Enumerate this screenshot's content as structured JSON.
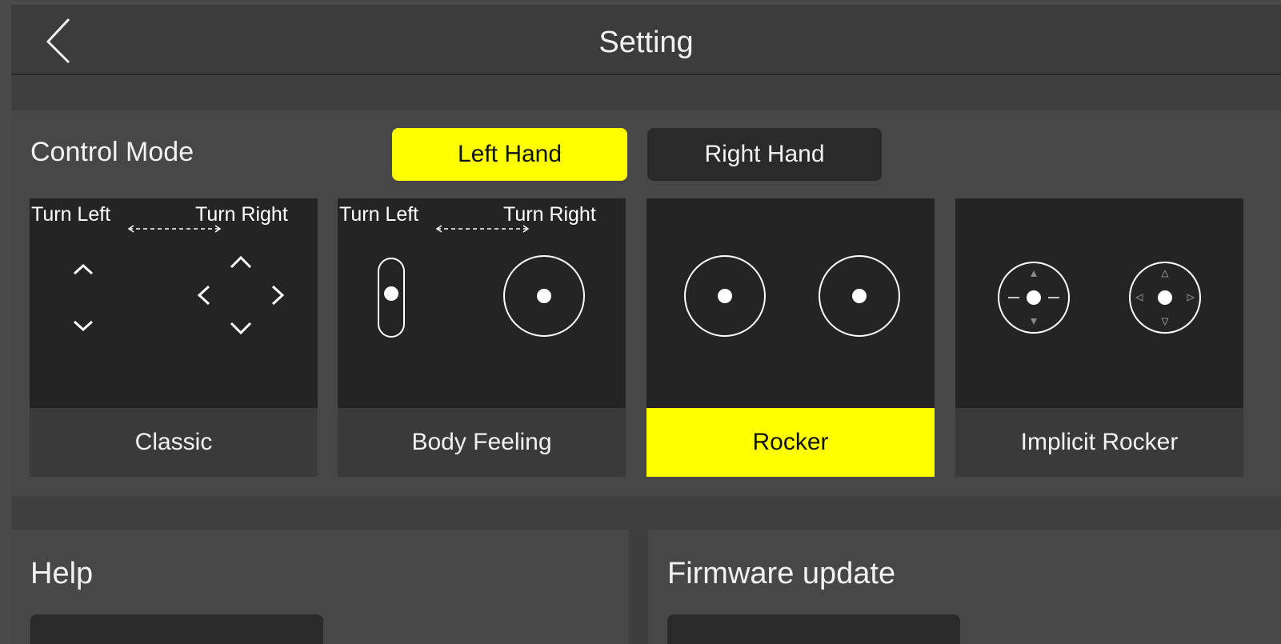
{
  "header": {
    "title": "Setting",
    "back_icon": "chevron-left-icon"
  },
  "control_mode": {
    "label": "Control Mode",
    "hands": [
      {
        "label": "Left Hand",
        "selected": true
      },
      {
        "label": "Right Hand",
        "selected": false
      }
    ],
    "modes": [
      {
        "name": "Classic",
        "turn_left": "Turn Left",
        "turn_right": "Turn Right",
        "selected": false
      },
      {
        "name": "Body Feeling",
        "turn_left": "Turn Left",
        "turn_right": "Turn Right",
        "selected": false
      },
      {
        "name": "Rocker",
        "selected": true
      },
      {
        "name": "Implicit Rocker",
        "selected": false
      }
    ]
  },
  "help": {
    "title": "Help"
  },
  "firmware": {
    "title": "Firmware update"
  },
  "colors": {
    "accent": "#ffff00",
    "background": "#3e3e3e",
    "card": "#242424"
  }
}
